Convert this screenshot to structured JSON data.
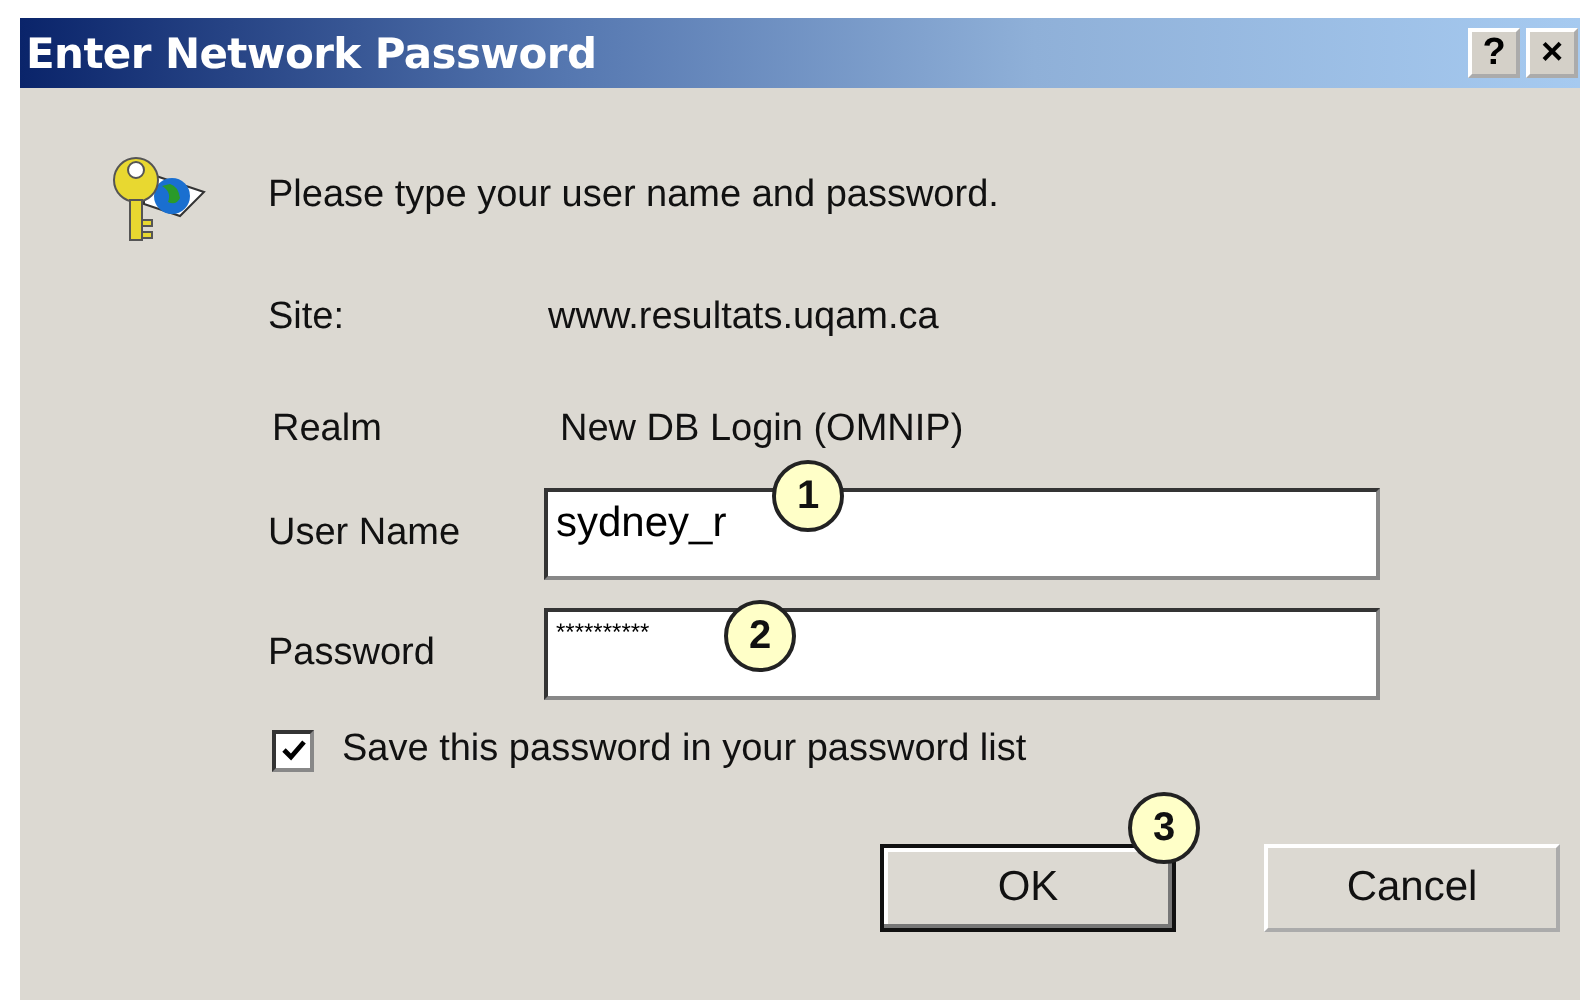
{
  "window": {
    "title": "Enter Network Password",
    "title_buttons": [
      "?",
      "×"
    ]
  },
  "message": "Please type your user name and password.",
  "info": [
    {
      "label": "Site:",
      "value": "www.resultats.uqam.ca"
    },
    {
      "label": "Realm",
      "value": "New DB Login  (OMNIP)"
    }
  ],
  "fields": [
    {
      "label": "User Name",
      "value": "sydney_r",
      "callout": "1"
    },
    {
      "label": "Password",
      "value": "**********",
      "callout": "2"
    }
  ],
  "save_password": {
    "label": "Save this password in your password list",
    "checked": true
  },
  "buttons": [
    {
      "label": "OK",
      "default": true,
      "callout": "3"
    },
    {
      "label": "Cancel",
      "default": false
    }
  ]
}
